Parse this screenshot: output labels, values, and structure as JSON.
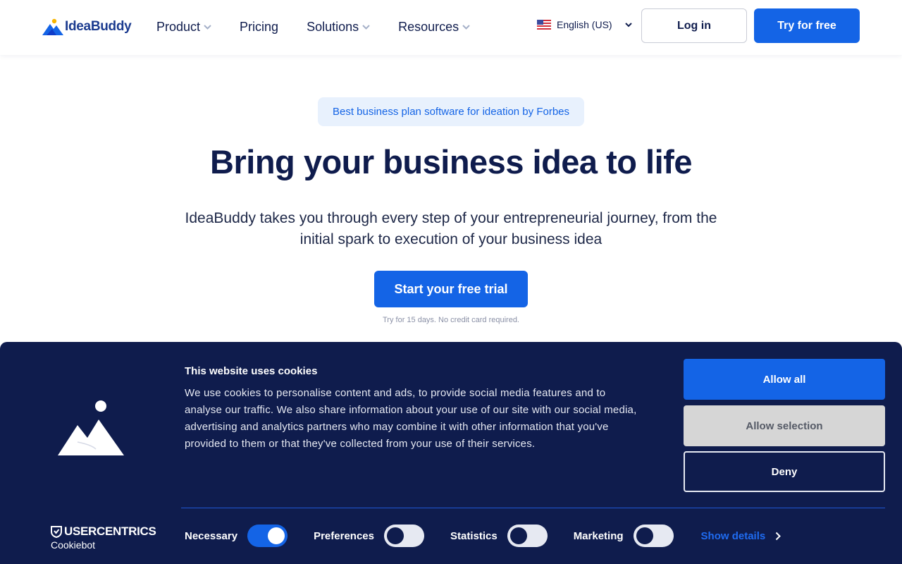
{
  "brand": {
    "name": "IdeaBuddy"
  },
  "nav": {
    "items": [
      {
        "label": "Product",
        "has_dropdown": true
      },
      {
        "label": "Pricing",
        "has_dropdown": false
      },
      {
        "label": "Solutions",
        "has_dropdown": true
      },
      {
        "label": "Resources",
        "has_dropdown": true
      }
    ],
    "language": "English (US)",
    "login_label": "Log in",
    "try_label": "Try for free"
  },
  "hero": {
    "badge": "Best business plan software for ideation by Forbes",
    "title": "Bring your business idea to life",
    "subtitle": "IdeaBuddy takes you through every step of your entrepreneurial journey, from the initial spark to execution of your business idea",
    "cta_label": "Start your free trial",
    "cta_note": "Try for 15 days. No credit card required."
  },
  "cookie": {
    "title": "This website uses cookies",
    "text": "We use cookies to personalise content and ads, to provide social media features and to analyse our traffic. We also share information about your use of our site with our social media, advertising and analytics partners who may combine it with other information that you've provided to them or that they've collected from your use of their services.",
    "allow_all": "Allow all",
    "allow_selection": "Allow selection",
    "deny": "Deny",
    "provider_brand": "USERCENTRICS",
    "provider_name": "Cookiebot",
    "toggles": [
      {
        "label": "Necessary",
        "on": true
      },
      {
        "label": "Preferences",
        "on": false
      },
      {
        "label": "Statistics",
        "on": false
      },
      {
        "label": "Marketing",
        "on": false
      }
    ],
    "show_details": "Show details"
  },
  "colors": {
    "primary": "#1464e6",
    "navy": "#0f1c4d",
    "badge_bg": "#e8f1fd"
  }
}
